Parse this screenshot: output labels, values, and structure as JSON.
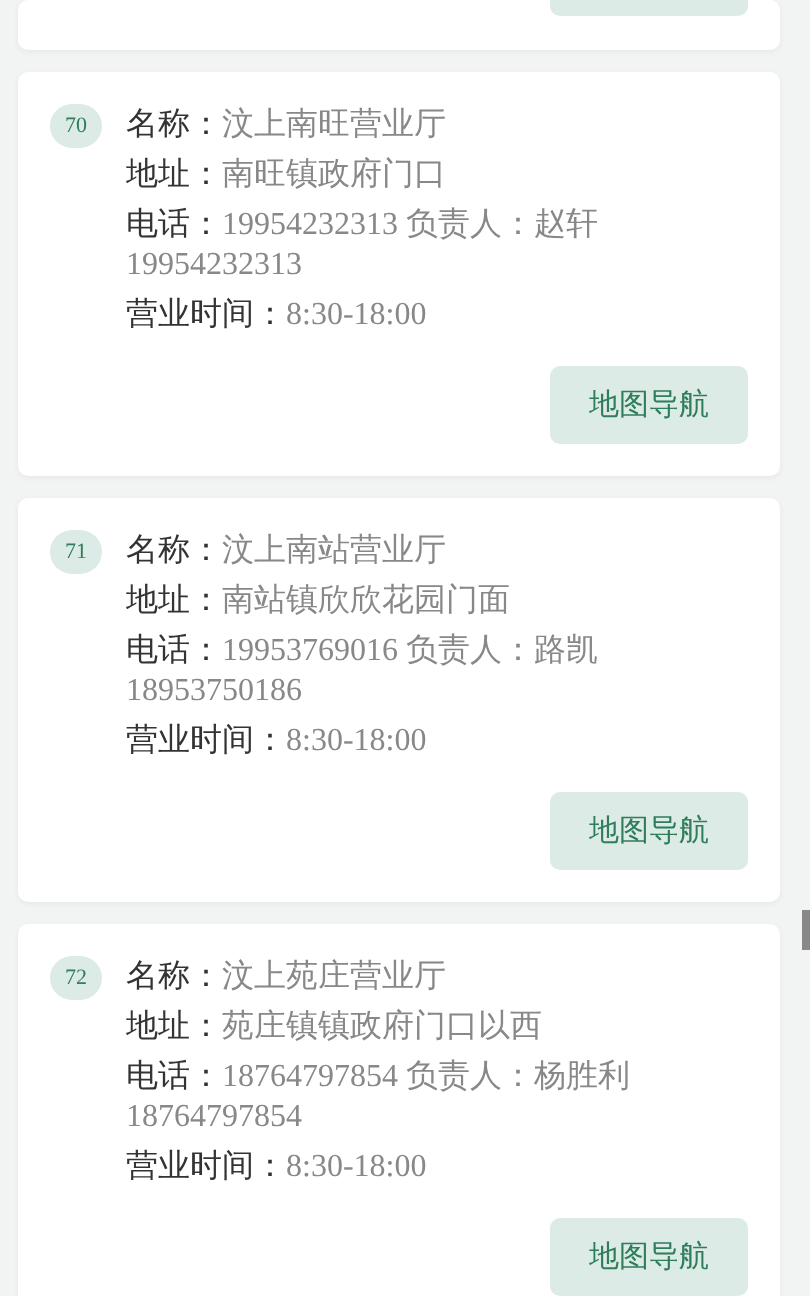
{
  "stores": [
    {
      "kind": "partial"
    },
    {
      "kind": "full",
      "number": "70",
      "fields": [
        {
          "label": "名称：",
          "value": "汶上南旺营业厅"
        },
        {
          "label": "地址：",
          "value": "南旺镇政府门口"
        },
        {
          "label": "电话：",
          "value": "19954232313 负责人：赵轩 19954232313"
        },
        {
          "label": "营业时间：",
          "value": "8:30-18:00"
        }
      ],
      "button": "地图导航"
    },
    {
      "kind": "full",
      "number": "71",
      "fields": [
        {
          "label": "名称：",
          "value": "汶上南站营业厅"
        },
        {
          "label": "地址：",
          "value": "南站镇欣欣花园门面"
        },
        {
          "label": "电话：",
          "value": "19953769016 负责人：路凯 18953750186"
        },
        {
          "label": "营业时间：",
          "value": "8:30-18:00"
        }
      ],
      "button": "地图导航"
    },
    {
      "kind": "full",
      "number": "72",
      "fields": [
        {
          "label": "名称：",
          "value": "汶上苑庄营业厅"
        },
        {
          "label": "地址：",
          "value": "苑庄镇镇政府门口以西"
        },
        {
          "label": "电话：",
          "value": "18764797854 负责人：杨胜利 18764797854"
        },
        {
          "label": "营业时间：",
          "value": "8:30-18:00"
        }
      ],
      "button": "地图导航"
    }
  ]
}
